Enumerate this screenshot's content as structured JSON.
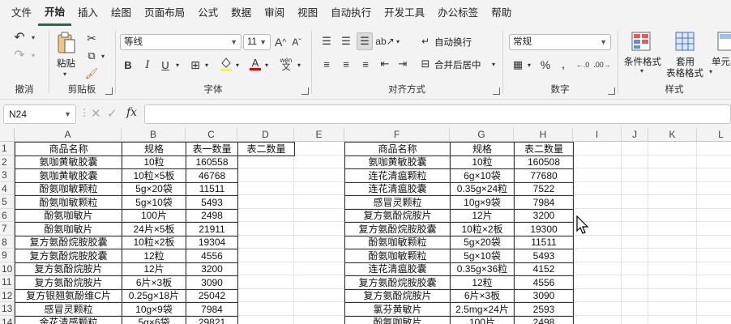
{
  "menu": [
    "文件",
    "开始",
    "插入",
    "绘图",
    "页面布局",
    "公式",
    "数据",
    "审阅",
    "视图",
    "自动执行",
    "开发工具",
    "办公标签",
    "帮助"
  ],
  "active_menu_index": 1,
  "ribbon": {
    "undo_group": "撤消",
    "clipboard": {
      "paste": "粘贴",
      "label": "剪贴板"
    },
    "font": {
      "name": "等线",
      "size": "11",
      "label": "字体",
      "phonetic": "wén"
    },
    "alignment": {
      "wrap": "自动换行",
      "merge": "合并后居中",
      "label": "对齐方式"
    },
    "number": {
      "format": "常规",
      "label": "数字"
    },
    "styles": {
      "conditional": "条件格式",
      "table_line1": "套用",
      "table_line2": "表格格式",
      "cell_styles": "单元",
      "label": "样式"
    }
  },
  "formula_bar": {
    "name_box": "N24",
    "formula": ""
  },
  "columns": [
    {
      "letter": "A",
      "width": 132
    },
    {
      "letter": "B",
      "width": 79
    },
    {
      "letter": "C",
      "width": 64
    },
    {
      "letter": "D",
      "width": 70
    },
    {
      "letter": "E",
      "width": 62
    },
    {
      "letter": "F",
      "width": 130
    },
    {
      "letter": "G",
      "width": 79
    },
    {
      "letter": "H",
      "width": 73
    },
    {
      "letter": "I",
      "width": 60
    },
    {
      "letter": "J",
      "width": 33
    },
    {
      "letter": "K",
      "width": 60
    },
    {
      "letter": "L",
      "width": 60
    }
  ],
  "row_numbers": [
    "1",
    "2",
    "3",
    "4",
    "5",
    "6",
    "7",
    "8",
    "9",
    "10",
    "11",
    "12",
    "13",
    "14"
  ],
  "table_left": [
    [
      "商品名称",
      "规格",
      "表一数量"
    ],
    [
      "氨咖黄敏胶囊",
      "10粒",
      "160558"
    ],
    [
      "氨咖黄敏胶囊",
      "10粒×5板",
      "46768"
    ],
    [
      "酚氨咖敏颗粒",
      "5g×20袋",
      "11511"
    ],
    [
      "酚氨咖敏颗粒",
      "5g×10袋",
      "5493"
    ],
    [
      "酚氨咖敏片",
      "100片",
      "2498"
    ],
    [
      "酚氨咖敏片",
      "24片×5板",
      "21911"
    ],
    [
      "复方氨酚烷胺胶囊",
      "10粒×2板",
      "19304"
    ],
    [
      "复方氨酚烷胺胶囊",
      "12粒",
      "4556"
    ],
    [
      "复方氨酚烷胺片",
      "12片",
      "3200"
    ],
    [
      "复方氨酚烷胺片",
      "6片×3板",
      "3090"
    ],
    [
      "复方银翘氨酚维C片",
      "0.25g×18片",
      "25042"
    ],
    [
      "感冒灵颗粒",
      "10g×9袋",
      "7984"
    ],
    [
      "金花清感颗粒",
      "5g×6袋",
      "29821"
    ]
  ],
  "table_d_header": "表二数量",
  "table_right": [
    [
      "商品名称",
      "规格",
      "表二数量"
    ],
    [
      "氨咖黄敏胶囊",
      "10粒",
      "160508"
    ],
    [
      "连花清瘟颗粒",
      "6g×10袋",
      "77680"
    ],
    [
      "连花清瘟胶囊",
      "0.35g×24粒",
      "7522"
    ],
    [
      "感冒灵颗粒",
      "10g×9袋",
      "7984"
    ],
    [
      "复方氨酚烷胺片",
      "12片",
      "3200"
    ],
    [
      "复方氨酚烷胺胶囊",
      "10粒×2板",
      "19300"
    ],
    [
      "酚氨咖敏颗粒",
      "5g×20袋",
      "11511"
    ],
    [
      "酚氨咖敏颗粒",
      "5g×10袋",
      "5493"
    ],
    [
      "连花清瘟胶囊",
      "0.35g×36粒",
      "4152"
    ],
    [
      "复方氨酚烷胺胶囊",
      "12粒",
      "4556"
    ],
    [
      "复方氨酚烷胺片",
      "6片×3板",
      "3090"
    ],
    [
      "氯芬黄敏片",
      "2.5mg×24片",
      "2593"
    ],
    [
      "酚氨咖敏片",
      "100片",
      "2498"
    ]
  ]
}
